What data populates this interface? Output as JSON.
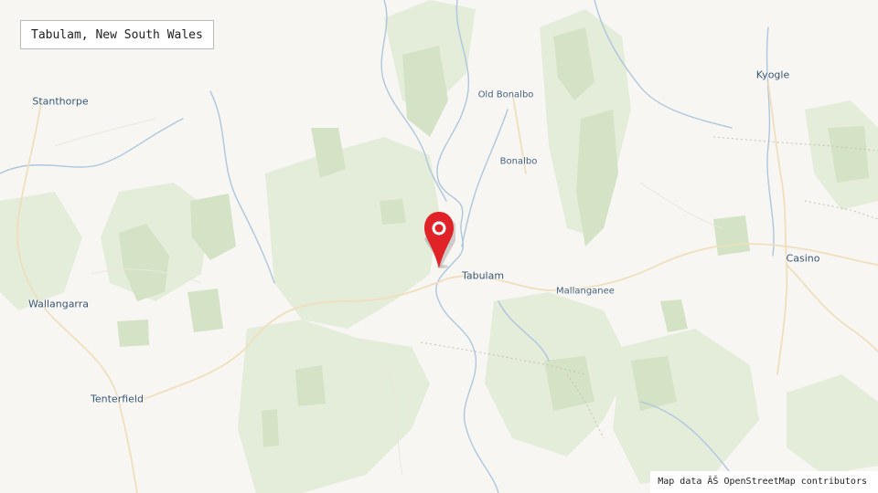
{
  "title": "Tabulam, New South Wales",
  "attribution": "Map data ÂŠ OpenStreetMap contributors",
  "marker": {
    "icon": "map-pin-icon",
    "color": "#e02329"
  },
  "places": {
    "stanthorpe": "Stanthorpe",
    "old_bonalbo": "Old Bonalbo",
    "kyogle": "Kyogle",
    "bonalbo": "Bonalbo",
    "tabulam": "Tabulam",
    "mallanganee": "Mallanganee",
    "casino": "Casino",
    "wallangarra": "Wallangarra",
    "tenterfield": "Tenterfield"
  },
  "colors": {
    "background": "#f8f6f2",
    "forest": "#dfe9d3",
    "forest_dark": "#d3e2c5",
    "river": "#aec7dc",
    "road": "#f0e3c6",
    "label": "#3f5d7a"
  }
}
